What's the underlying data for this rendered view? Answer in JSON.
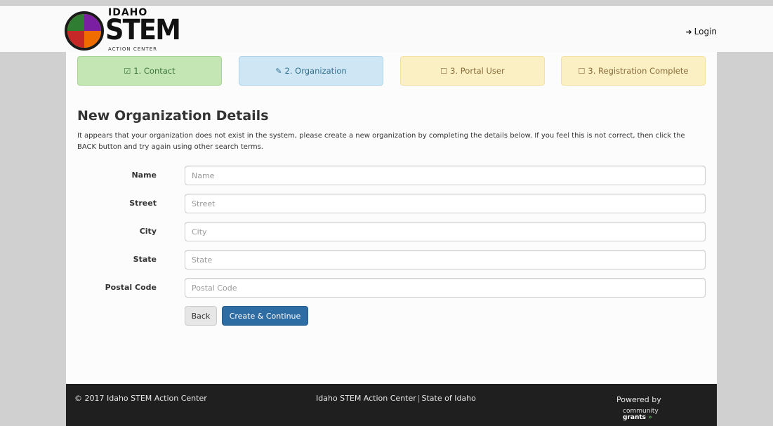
{
  "header": {
    "logo": {
      "top_text": "IDAHO",
      "main_text": "STEM",
      "sub_text": "ACTION CENTER",
      "icon": "idaho-map-icon"
    },
    "login_label": "Login",
    "login_icon": "sign-in-icon"
  },
  "steps": [
    {
      "label": "1. Contact",
      "icon": "check-square-icon",
      "state": "complete",
      "color": "#c3e6b4"
    },
    {
      "label": "2. Organization",
      "icon": "edit-icon",
      "state": "active",
      "color": "#cfe7f5"
    },
    {
      "label": "3. Portal User",
      "icon": "square-icon",
      "state": "pending",
      "color": "#fbf0c4"
    },
    {
      "label": "3. Registration Complete",
      "icon": "square-icon",
      "state": "pending",
      "color": "#fbf0c4"
    }
  ],
  "form": {
    "title": "New Organization Details",
    "description": "It appears that your organization does not exist in the system, please create a new organization by completing the details below. If you feel this is not correct, then click the BACK button and try again using other search terms.",
    "fields": [
      {
        "label": "Name",
        "placeholder": "Name",
        "value": ""
      },
      {
        "label": "Street",
        "placeholder": "Street",
        "value": ""
      },
      {
        "label": "City",
        "placeholder": "City",
        "value": ""
      },
      {
        "label": "State",
        "placeholder": "State",
        "value": ""
      },
      {
        "label": "Postal Code",
        "placeholder": "Postal Code",
        "value": ""
      }
    ],
    "back_label": "Back",
    "create_label": "Create & Continue",
    "primary_color": "#2e6da4"
  },
  "footer": {
    "copyright": "© 2017 Idaho STEM Action Center",
    "link_center": "Idaho STEM Action Center",
    "link_state": "State of Idaho",
    "powered_by": "Powered by",
    "brand_line1": "community",
    "brand_line2": "grants"
  }
}
